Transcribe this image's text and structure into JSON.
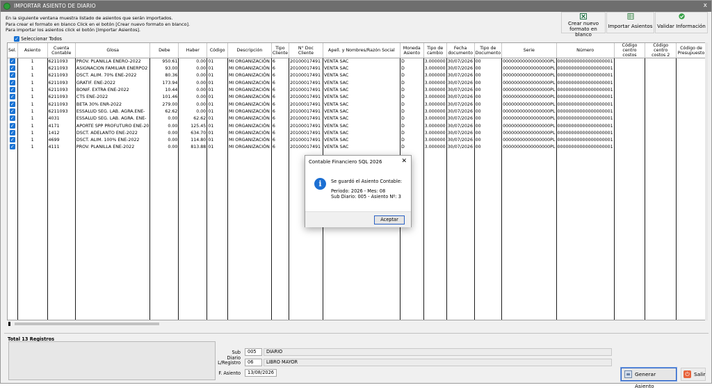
{
  "window": {
    "title": "IMPORTAR ASIENTO DE DIARIO",
    "close_glyph": "x",
    "app_icon": "green-circle-app-icon"
  },
  "info_lines": [
    "En la siguiente ventana muestra listado de asientos que serán importados.",
    "Para crear el formato en blanco Click en el botón  [Crear nuevo formato en blanco].",
    "Para importar los asientos click el botón  [Importar Asientos]."
  ],
  "toolbar": {
    "crear_label_1": "Crear nuevo",
    "crear_label_2": "formato en blanco",
    "importar_label": "Importar Asientos",
    "validar_label": "Validar Información",
    "crear_icon": "excel-icon",
    "importar_icon": "import-sheet-icon",
    "validar_icon": "green-check-icon"
  },
  "select_all_label": "Seleccionar Todos",
  "columns": [
    "Sel.",
    "Asiento",
    "Cuenta Contable",
    "Glosa",
    "Debe",
    "Haber",
    "Código",
    "Descripción",
    "Tipo Cliente",
    "N° Doc Cliente",
    "Apell. y Nombres/Razón Social",
    "Moneda Asiento",
    "Tipo de cambio",
    "Fecha documento",
    "Tipo de Documento",
    "Serie",
    "Número",
    "Código centro costos",
    "Código centro costos 2",
    "Código de Presupuesto"
  ],
  "rows": [
    {
      "asiento": "1",
      "cuenta": "6211093",
      "glosa": "PROV. PLANILLA ENERO-2022",
      "debe": "950.61",
      "haber": "0.00",
      "codigo": "01",
      "desc": "MI ORGANIZACIÓN",
      "tipo": "6",
      "doc": "20100017491",
      "razon": "VENTA SAC",
      "moneda": "D",
      "cambio": "3.000000",
      "fecha": "30/07/2026",
      "tipodoc": "00",
      "serie": "00000000000000000PL",
      "numero": "00000000000000000001"
    },
    {
      "asiento": "1",
      "cuenta": "6211093",
      "glosa": "ASIGNACION FAMILIAR ENERPO2",
      "debe": "93.00",
      "haber": "0.00",
      "codigo": "01",
      "desc": "MI ORGANIZACIÓN",
      "tipo": "6",
      "doc": "20100017491",
      "razon": "VENTA SAC",
      "moneda": "D",
      "cambio": "3.000000",
      "fecha": "30/07/2026",
      "tipodoc": "00",
      "serie": "00000000000000000PL",
      "numero": "00000000000000000001"
    },
    {
      "asiento": "1",
      "cuenta": "6211093",
      "glosa": "DSCT. ALIM. 70% ENE-2022",
      "debe": "80.36",
      "haber": "0.00",
      "codigo": "01",
      "desc": "MI ORGANIZACIÓN",
      "tipo": "6",
      "doc": "20100017491",
      "razon": "VENTA SAC",
      "moneda": "D",
      "cambio": "3.000000",
      "fecha": "30/07/2026",
      "tipodoc": "00",
      "serie": "00000000000000000PL",
      "numero": "00000000000000000001"
    },
    {
      "asiento": "1",
      "cuenta": "6211093",
      "glosa": "GRATIF. ENE-2022",
      "debe": "173.94",
      "haber": "0.00",
      "codigo": "01",
      "desc": "MI ORGANIZACIÓN",
      "tipo": "6",
      "doc": "20100017491",
      "razon": "VENTA SAC",
      "moneda": "D",
      "cambio": "3.000000",
      "fecha": "30/07/2026",
      "tipodoc": "00",
      "serie": "00000000000000000PL",
      "numero": "00000000000000000001"
    },
    {
      "asiento": "1",
      "cuenta": "6211093",
      "glosa": "BONIF. EXTRA ENE-2022",
      "debe": "10.44",
      "haber": "0.00",
      "codigo": "01",
      "desc": "MI ORGANIZACIÓN",
      "tipo": "6",
      "doc": "20100017491",
      "razon": "VENTA SAC",
      "moneda": "D",
      "cambio": "3.000000",
      "fecha": "30/07/2026",
      "tipodoc": "00",
      "serie": "00000000000000000PL",
      "numero": "00000000000000000001"
    },
    {
      "asiento": "1",
      "cuenta": "6211093",
      "glosa": "CTS ENE-2022",
      "debe": "101.46",
      "haber": "0.00",
      "codigo": "01",
      "desc": "MI ORGANIZACIÓN",
      "tipo": "6",
      "doc": "20100017491",
      "razon": "VENTA SAC",
      "moneda": "D",
      "cambio": "3.000000",
      "fecha": "30/07/2026",
      "tipodoc": "00",
      "serie": "00000000000000000PL",
      "numero": "00000000000000000001"
    },
    {
      "asiento": "1",
      "cuenta": "6211093",
      "glosa": "BETA 30% ENR-2022",
      "debe": "279.00",
      "haber": "0.00",
      "codigo": "01",
      "desc": "MI ORGANIZACIÓN",
      "tipo": "6",
      "doc": "20100017491",
      "razon": "VENTA SAC",
      "moneda": "D",
      "cambio": "3.000000",
      "fecha": "30/07/2026",
      "tipodoc": "00",
      "serie": "00000000000000000PL",
      "numero": "00000000000000000001"
    },
    {
      "asiento": "1",
      "cuenta": "6211093",
      "glosa": "ESSALUD SEG. LAB. AGRA.ENE-",
      "debe": "62.62",
      "haber": "0.00",
      "codigo": "01",
      "desc": "MI ORGANIZACIÓN",
      "tipo": "6",
      "doc": "20100017491",
      "razon": "VENTA SAC",
      "moneda": "D",
      "cambio": "3.000000",
      "fecha": "30/07/2026",
      "tipodoc": "00",
      "serie": "00000000000000000PL",
      "numero": "00000000000000000001"
    },
    {
      "asiento": "1",
      "cuenta": "4031",
      "glosa": "ESSALUD SEG. LAB. AGRA. ENE-",
      "debe": "0.00",
      "haber": "62.62",
      "codigo": "01",
      "desc": "MI ORGANIZACIÓN",
      "tipo": "6",
      "doc": "20100017491",
      "razon": "VENTA SAC",
      "moneda": "D",
      "cambio": "3.000000",
      "fecha": "30/07/2026",
      "tipodoc": "00",
      "serie": "00000000000000000PL",
      "numero": "00000000000000000001"
    },
    {
      "asiento": "1",
      "cuenta": "4171",
      "glosa": "APORTE SPP PROFUTURO ENE-20",
      "debe": "0.00",
      "haber": "125.45",
      "codigo": "01",
      "desc": "MI ORGANIZACIÓN",
      "tipo": "6",
      "doc": "20100017491",
      "razon": "VENTA SAC",
      "moneda": "D",
      "cambio": "3.000000",
      "fecha": "30/07/2026",
      "tipodoc": "00",
      "serie": "00000000000000000PL",
      "numero": "00000000000000000001"
    },
    {
      "asiento": "1",
      "cuenta": "1412",
      "glosa": "DSCT. ADELANTO ENE-2022",
      "debe": "0.00",
      "haber": "634.70",
      "codigo": "01",
      "desc": "MI ORGANIZACIÓN",
      "tipo": "6",
      "doc": "20100017491",
      "razon": "VENTA SAC",
      "moneda": "D",
      "cambio": "3.000000",
      "fecha": "30/07/2026",
      "tipodoc": "00",
      "serie": "00000000000000000PL",
      "numero": "00000000000000000001"
    },
    {
      "asiento": "1",
      "cuenta": "4699",
      "glosa": "DSCT. ALIM. 100% ENE-2022",
      "debe": "0.00",
      "haber": "114.80",
      "codigo": "01",
      "desc": "MI ORGANIZACIÓN",
      "tipo": "6",
      "doc": "20100017491",
      "razon": "VENTA SAC",
      "moneda": "D",
      "cambio": "3.000000",
      "fecha": "30/07/2026",
      "tipodoc": "00",
      "serie": "00000000000000000PL",
      "numero": "00000000000000000001"
    },
    {
      "asiento": "1",
      "cuenta": "4111",
      "glosa": "PROV. PLANILLA ENE-2022",
      "debe": "0.00",
      "haber": "813.88",
      "codigo": "01",
      "desc": "MI ORGANIZACIÓN",
      "tipo": "6",
      "doc": "20100017491",
      "razon": "VENTA SAC",
      "moneda": "D",
      "cambio": "3.000000",
      "fecha": "30/07/2026",
      "tipodoc": "00",
      "serie": "00000000000000000PL",
      "numero": "00000000000000000001"
    }
  ],
  "total_label": "Total 13 Registros",
  "footer": {
    "subdiario_label": "Sub Diario",
    "subdiario_code": "005",
    "subdiario_desc": "DIARIO",
    "lregistro_label": "L/Registro",
    "lregistro_code": "06",
    "lregistro_desc": "LIBRO MAYOR",
    "fasiento_label": "F. Asiento",
    "fasiento_value": "13/08/2026"
  },
  "buttons": {
    "generar_label": "Generar Asiento",
    "salir_label": "Salir"
  },
  "dialog": {
    "title": "Contable Financiero SQL 2026",
    "line1": "Se guardó el Asiento Contable:",
    "line2": "Periodo: 2026 - Mes: 08",
    "line3": "Sub Diario: 005 - Asiento Nº: 3",
    "ok_label": "Aceptar",
    "icon": "info-icon"
  },
  "colors": {
    "titlebar": "#6e6e6e",
    "checkbox": "#1a73d4",
    "info_icon": "#1c6fd2"
  }
}
